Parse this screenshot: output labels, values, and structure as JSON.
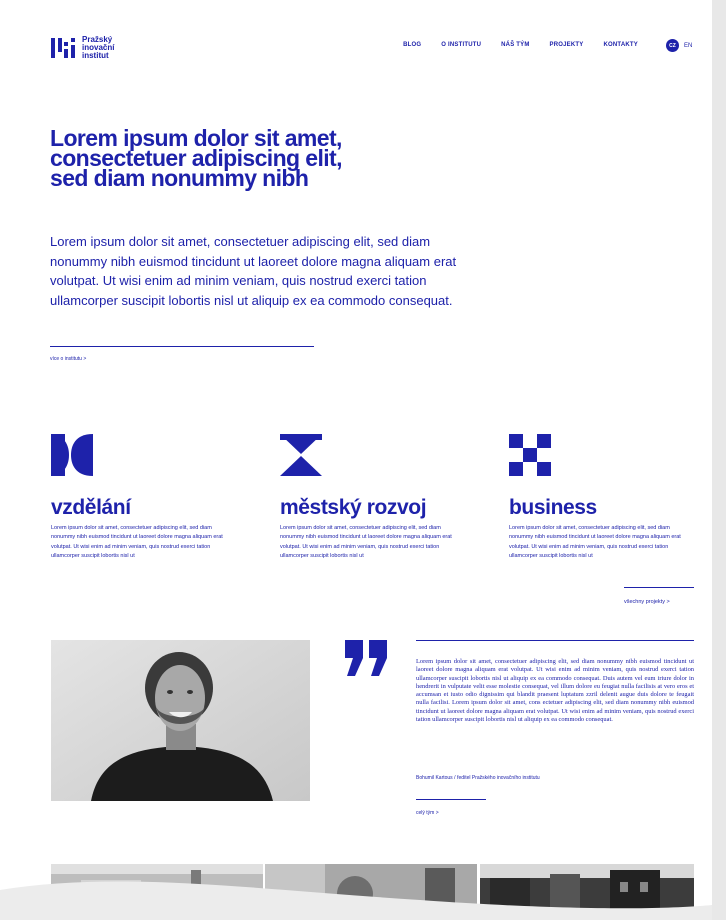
{
  "header": {
    "logo_lines": [
      "Pražský",
      "inovační",
      "institut"
    ],
    "nav": [
      "BLOG",
      "O INSTITUTU",
      "NÁŠ TÝM",
      "PROJEKTY",
      "KONTAKTY"
    ],
    "lang_active": "CZ",
    "lang_other": "EN"
  },
  "hero": {
    "title": "Lorem ipsum dolor sit amet, consectetuer adipiscing elit, sed diam nonummy nibh",
    "text": "Lorem ipsum dolor sit amet, consectetuer adipiscing elit, sed diam nonummy nibh euismod tincidunt ut laoreet dolore magna aliquam erat volutpat. Ut wisi enim ad minim veniam, quis nostrud exerci tation ullamcorper suscipit lobortis nisl ut aliquip ex ea commodo consequat.",
    "link": "více o institutu  >"
  },
  "categories": [
    {
      "title": "vzdělání",
      "text": "Lorem ipsum dolor sit amet, consectetuer adipiscing elit, sed diam nonummy nibh euismod tincidunt ut laoreet dolore magna aliquam erat volutpat. Ut wisi enim ad minim veniam, quis nostrud exerci tation ullamcorper suscipit lobortis nisl ut",
      "icon": "bowtie-icon"
    },
    {
      "title": "městský rozvoj",
      "text": "Lorem ipsum dolor sit amet, consectetuer adipiscing elit, sed diam nonummy nibh euismod tincidunt ut laoreet dolore magna aliquam erat volutpat. Ut wisi enim ad minim veniam, quis nostrud exerci tation ullamcorper suscipit lobortis nisl ut",
      "icon": "hourglass-icon"
    },
    {
      "title": "business",
      "text": "Lorem ipsum dolor sit amet, consectetuer adipiscing elit, sed diam nonummy nibh euismod tincidunt ut laoreet dolore magna aliquam erat volutpat. Ut wisi enim ad minim veniam, quis nostrud exerci tation ullamcorper suscipit lobortis nisl ut",
      "icon": "checker-icon"
    }
  ],
  "all_projects": "všechny projekty  >",
  "quote": {
    "text": "Lorem ipsum dolor sit amet, consectetuer adipiscing elit, sed diam nonummy nibh euismod tincidunt ut laoreet dolore magna aliquam erat volutpat. Ut wisi enim ad minim veniam, quis nostrud exerci tation ullamcorper suscipit lobortis nisl ut aliquip ex ea commodo consequat. Duis autem vel eum iriure dolor in hendrerit in vulputate velit esse molestie consequat, vel illum dolore eu feugiat nulla facilisis at vero eros et accumsan et iusto odio dignissim qui blandit praesent luptatum zzril delenit augue duis dolore te feugait nulla facilisi. Lorem ipsum dolor sit amet, cons ectetuer adipiscing elit, sed diam nonummy nibh euismod tincidunt ut laoreet dolore magna aliquam erat volutpat. Ut wisi enim ad minim veniam, quis nostrud exerci tation ullamcorper suscipit lobortis nisl ut aliquip ex ea commodo consequat.",
    "author": "Bohumil Kartous  /  ředitel Pražského inovačního institutu",
    "team_link": "celý tým  >"
  },
  "colors": {
    "brand": "#1e22aa",
    "background": "#ffffff",
    "frame": "#e8e8e8"
  }
}
